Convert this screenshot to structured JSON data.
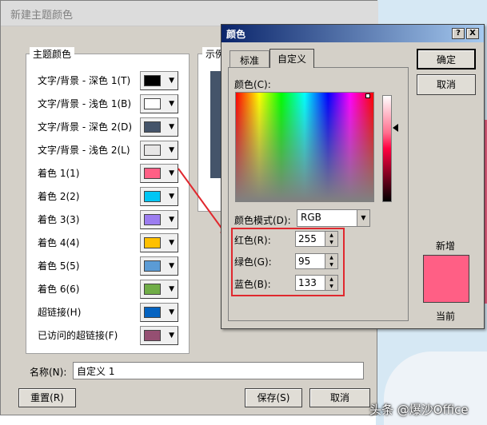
{
  "main_dialog": {
    "title": "新建主题颜色",
    "group_label": "主题颜色",
    "preview_label": "示例",
    "rows": [
      {
        "label": "文字/背景 - 深色 1(T)",
        "color": "#000000"
      },
      {
        "label": "文字/背景 - 浅色 1(B)",
        "color": "#ffffff"
      },
      {
        "label": "文字/背景 - 深色 2(D)",
        "color": "#44546a"
      },
      {
        "label": "文字/背景 - 浅色 2(L)",
        "color": "#e7e6e6"
      },
      {
        "label": "着色 1(1)",
        "color": "#ff5f85"
      },
      {
        "label": "着色 2(2)",
        "color": "#00c6f4"
      },
      {
        "label": "着色 3(3)",
        "color": "#9c7df0"
      },
      {
        "label": "着色 4(4)",
        "color": "#ffc000"
      },
      {
        "label": "着色 5(5)",
        "color": "#5b9bd5"
      },
      {
        "label": "着色 6(6)",
        "color": "#70ad47"
      },
      {
        "label": "超链接(H)",
        "color": "#0563c1"
      },
      {
        "label": "已访问的超链接(F)",
        "color": "#954f72"
      }
    ],
    "name_label": "名称(N):",
    "name_value": "自定义 1",
    "reset_label": "重置(R)",
    "save_label": "保存(S)",
    "cancel_label": "取消"
  },
  "color_dialog": {
    "title": "颜色",
    "help_label": "?",
    "close_label": "X",
    "tabs": [
      "标准",
      "自定义"
    ],
    "active_tab": "自定义",
    "colors_label": "颜色(C):",
    "mode_label": "颜色模式(D):",
    "mode_value": "RGB",
    "red_label": "红色(R):",
    "red_value": "255",
    "green_label": "绿色(G):",
    "green_value": "95",
    "blue_label": "蓝色(B):",
    "blue_value": "133",
    "ok_label": "确定",
    "cancel_label": "取消",
    "new_label": "新增",
    "current_label": "当前",
    "preview_color": "#ff5f85"
  },
  "watermark": "头条 @爆沙Office",
  "accent_colors": {
    "annotation_red": "#e0282e"
  }
}
